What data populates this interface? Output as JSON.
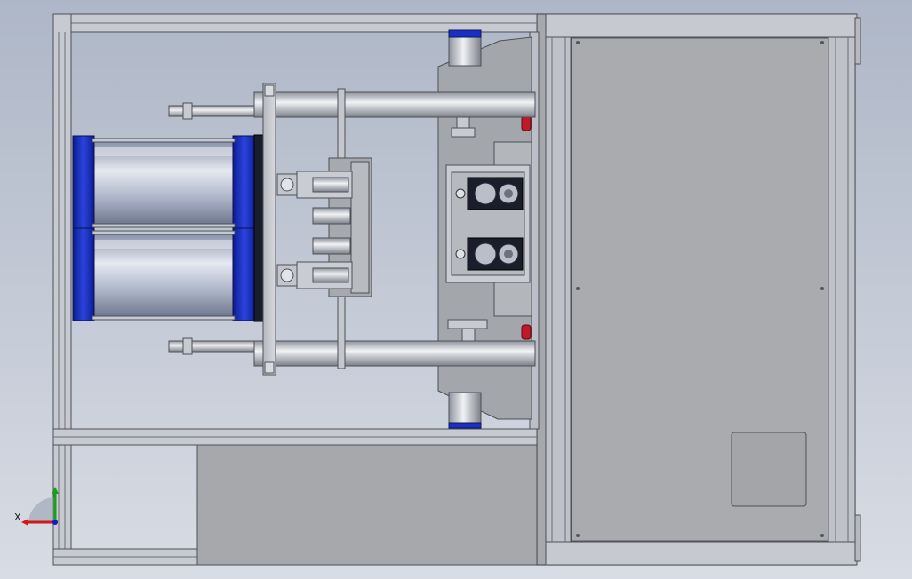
{
  "viewport": {
    "background_top": "#aeb7c7",
    "background_bottom": "#d8dce4"
  },
  "colors": {
    "frame": "#c9ccd3",
    "frame_edge": "#5a5e66",
    "panel": "#a9abaf",
    "cylinder_cap": "#1c2fc4",
    "cylinder_body": "#b9c0d4",
    "rod": "#d2d5dc",
    "red_stop": "#c01a2a"
  },
  "triad": {
    "x_label": "X",
    "x_axis_color": "#d01818",
    "y_axis_color": "#18a018",
    "z_axis_color": "#1818c0"
  }
}
